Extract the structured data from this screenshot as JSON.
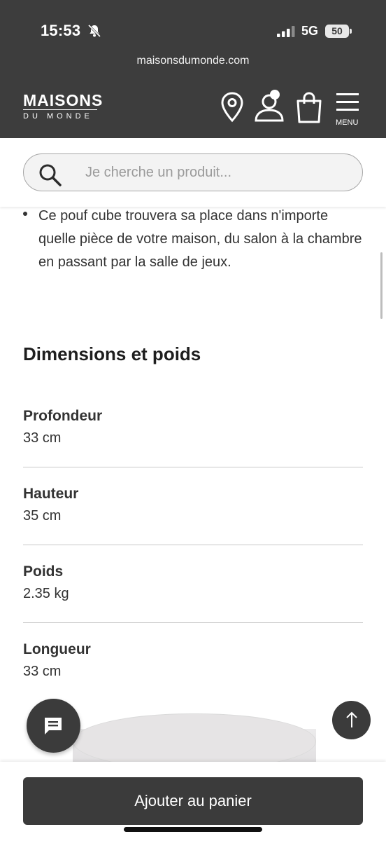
{
  "status_bar": {
    "time": "15:53",
    "network": "5G",
    "battery": "50",
    "icons": [
      "bell-muted-icon",
      "signal-icon",
      "battery-icon"
    ]
  },
  "browser": {
    "url": "maisonsdumonde.com"
  },
  "header": {
    "logo_main": "MAISONS",
    "logo_sub": "DU MONDE",
    "menu_label": "MENU",
    "icons": [
      "location-pin-icon",
      "account-icon",
      "shopping-bag-icon",
      "hamburger-menu-icon"
    ]
  },
  "search": {
    "placeholder": "Je cherche un produit..."
  },
  "description": {
    "bullet": "Ce pouf cube trouvera sa place dans n'importe quelle pièce de votre maison, du salon à la chambre en passant par la salle de jeux."
  },
  "dimensions": {
    "title": "Dimensions et poids",
    "rows": [
      {
        "label": "Profondeur",
        "value": "33 cm"
      },
      {
        "label": "Hauteur",
        "value": "35 cm"
      },
      {
        "label": "Poids",
        "value": "2.35 kg"
      },
      {
        "label": "Longueur",
        "value": "33 cm"
      }
    ]
  },
  "actions": {
    "add_to_cart": "Ajouter au panier",
    "chat_icon": "chat-icon",
    "scroll_top_icon": "arrow-up-icon"
  },
  "colors": {
    "header_bg": "#3d3d3d",
    "button_bg": "#3b3b3b",
    "text": "#333333",
    "divider": "#c8c8c8"
  }
}
